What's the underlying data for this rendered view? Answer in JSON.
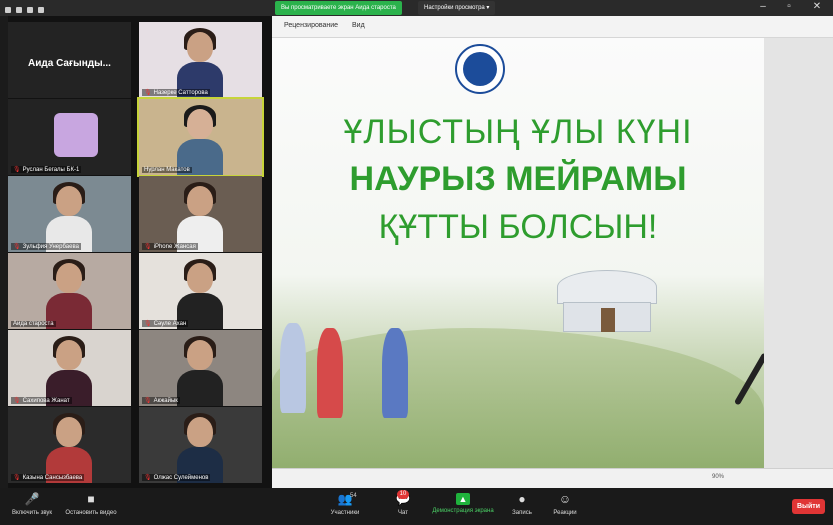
{
  "window": {
    "banner": "Вы просматриваете экран Аида староста",
    "view_options": "Настройки просмотра ▾"
  },
  "gallery": {
    "tiles": [
      {
        "label": "Аида Сағынды...",
        "type": "name-only"
      },
      {
        "label": "Назерке Сатторова",
        "type": "video"
      },
      {
        "label": "Руслан Бегалы БК-1",
        "type": "logo"
      },
      {
        "label": "Нурлан Макатов",
        "type": "video",
        "active": true
      },
      {
        "label": "Зульфия Унербаева",
        "type": "video"
      },
      {
        "label": "iPhone Жансая",
        "type": "video"
      },
      {
        "label": "Аида староста",
        "type": "video"
      },
      {
        "label": "Сәуле Ахан",
        "type": "video"
      },
      {
        "label": "Сахипова Жанат",
        "type": "video"
      },
      {
        "label": "Акжайык",
        "type": "video"
      },
      {
        "label": "Казына Сансызбаева",
        "type": "video"
      },
      {
        "label": "Олжас Сулейменов",
        "type": "video"
      }
    ]
  },
  "share": {
    "ribbon": [
      "Рецензирование",
      "Вид"
    ],
    "slide": {
      "line1": "ҰЛЫСТЫҢ ҰЛЫ КҮНІ",
      "line2": "НАУРЫЗ МЕЙРАМЫ",
      "line3": "ҚҰТТЫ БОЛСЫН!"
    },
    "zoom": "90%"
  },
  "toolbar": {
    "mute": "Включить звук",
    "video": "Остановить видео",
    "participants": "Участники",
    "participants_count": "54",
    "chat": "Чат",
    "chat_badge": "10",
    "share": "Демонстрация экрана",
    "record": "Запись",
    "reactions": "Реакции",
    "leave": "Выйти"
  },
  "colors": {
    "accent_green": "#2e9d2e",
    "leave_red": "#e03535",
    "active_outline": "#c7d43a"
  }
}
